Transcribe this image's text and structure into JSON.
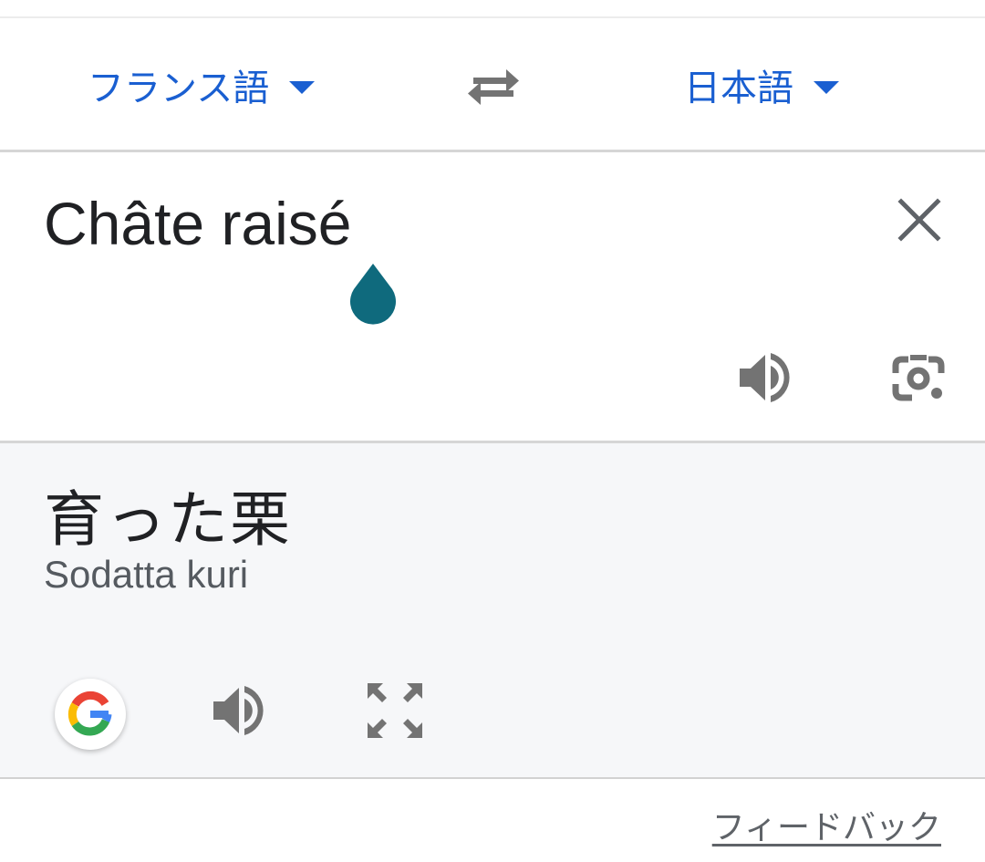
{
  "language_bar": {
    "source_language": "フランス語",
    "target_language": "日本語",
    "swap_icon": "swap-arrows-icon"
  },
  "source": {
    "text": "Châte raisé",
    "clear_icon": "close-icon",
    "speak_icon": "speaker-icon",
    "camera_icon": "camera-lens-icon"
  },
  "result": {
    "translation": "育った栗",
    "transliteration": "Sodatta kuri",
    "google_icon": "google-g-icon",
    "speak_icon": "speaker-icon",
    "expand_icon": "fullscreen-icon"
  },
  "footer": {
    "feedback_label": "フィードバック"
  },
  "colors": {
    "accent_blue": "#1a5fd1",
    "icon_gray": "#737373",
    "cursor_handle": "#0f6a7d",
    "result_background": "#f6f7f9"
  }
}
